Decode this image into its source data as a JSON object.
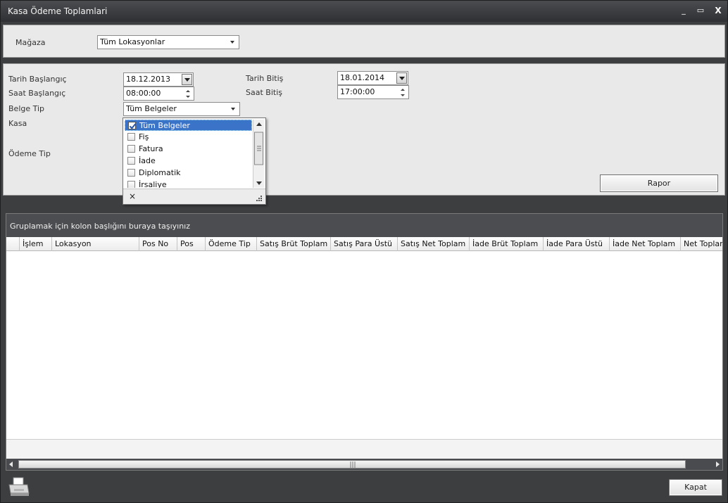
{
  "window": {
    "title": "Kasa Ödeme Toplamlari",
    "minimize": "_",
    "maximize": "▭",
    "close": "X"
  },
  "store": {
    "label": "Mağaza",
    "value": "Tüm Lokasyonlar"
  },
  "filters": {
    "start_date_label": "Tarih Başlangıç",
    "start_date": "18.12.2013",
    "end_date_label": "Tarih Bitiş",
    "end_date": "18.01.2014",
    "start_time_label": "Saat Başlangıç",
    "start_time": "08:00:00",
    "end_time_label": "Saat Bitiş",
    "end_time": "17:00:00",
    "doc_type_label": "Belge Tip",
    "doc_type": "Tüm Belgeler",
    "register_label": "Kasa",
    "payment_type_label": "Ödeme Tip"
  },
  "doc_type_options": [
    {
      "label": "Tüm Belgeler",
      "checked": true
    },
    {
      "label": "Fiş",
      "checked": false
    },
    {
      "label": "Fatura",
      "checked": false
    },
    {
      "label": "İade",
      "checked": false
    },
    {
      "label": "Diplomatik",
      "checked": false
    },
    {
      "label": "İrsaliye",
      "checked": false
    }
  ],
  "dropdown_close": "×",
  "report_button": "Rapor",
  "grid": {
    "group_hint": "Gruplamak için kolon başlığını buraya taşıyınız",
    "columns": [
      "İşlem",
      "Lokasyon",
      "Pos No",
      "Pos",
      "Ödeme Tip",
      "Satış Brüt Toplam",
      "Satış Para Üstü",
      "Satış Net Toplam",
      "İade Brüt Toplam",
      "İade Para Üstü",
      "İade Net Toplam",
      "Net Toplam"
    ]
  },
  "close_button": "Kapat"
}
